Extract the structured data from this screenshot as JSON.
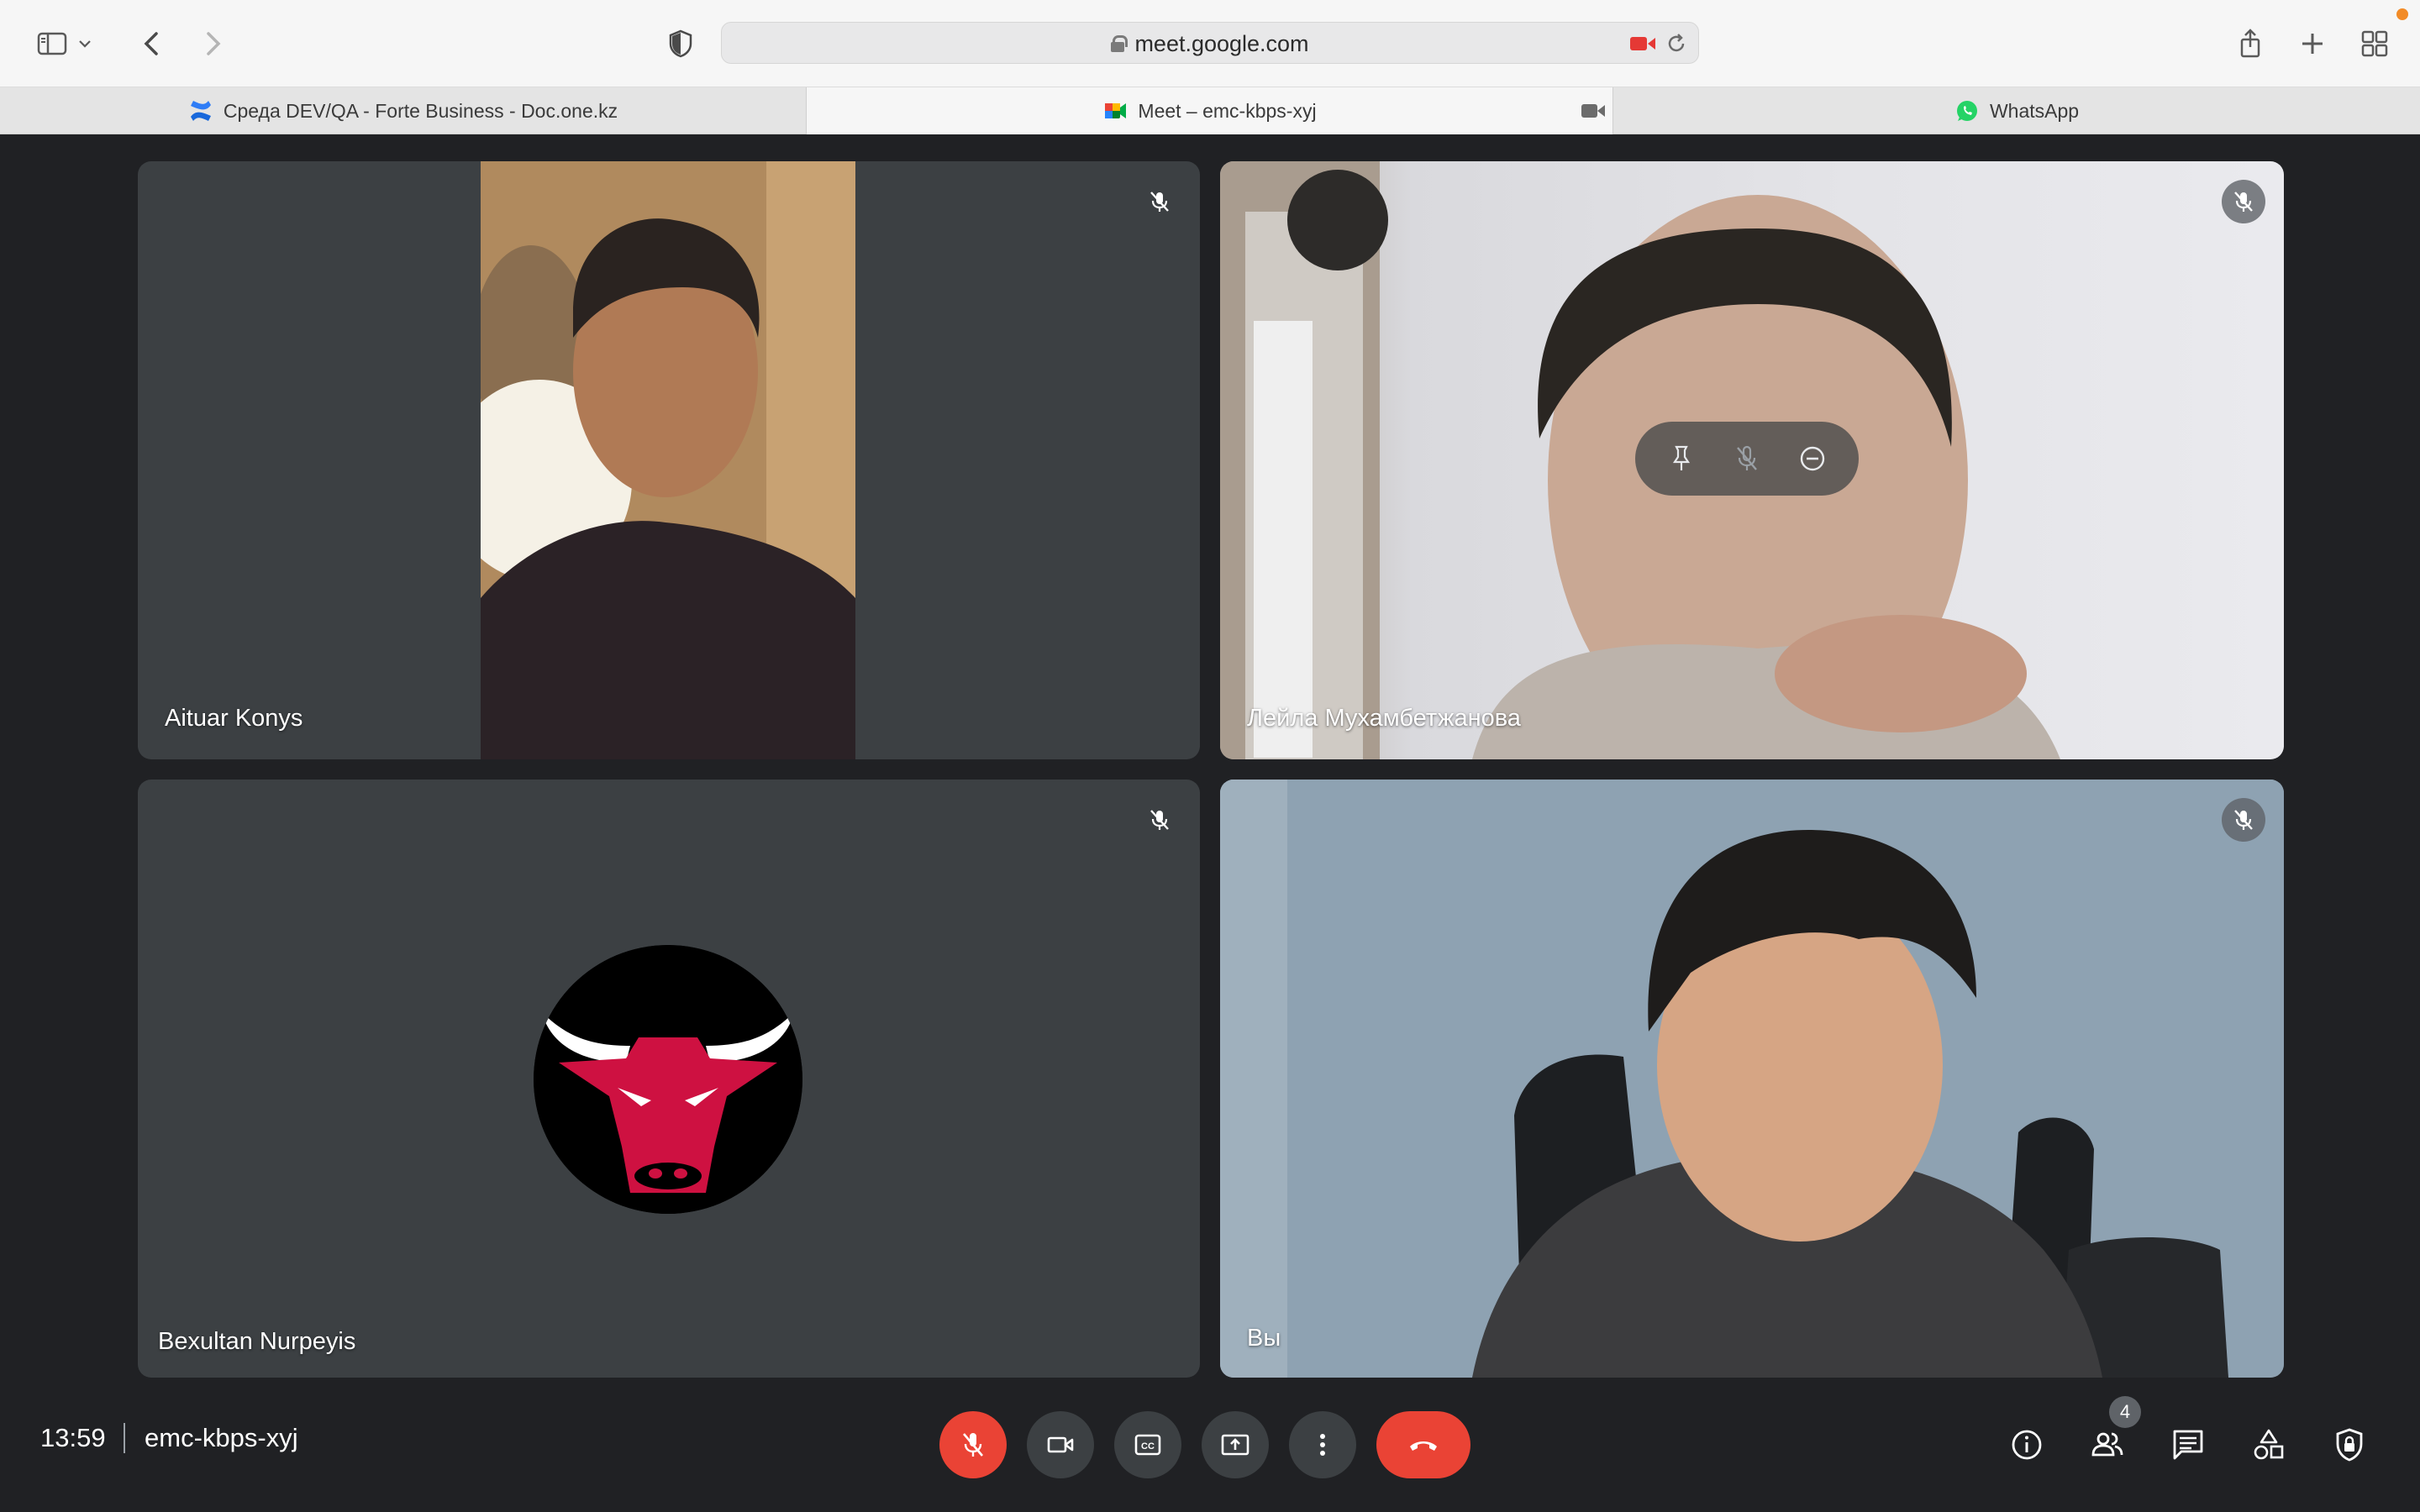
{
  "browser": {
    "url": "meet.google.com",
    "tabs": [
      {
        "label": "Среда DEV/QA - Forte Business - Doc.one.kz",
        "icon": "confluence-icon"
      },
      {
        "label": "Meet – emc-kbps-xyj",
        "icon": "google-meet-icon",
        "active": true
      },
      {
        "label": "WhatsApp",
        "icon": "whatsapp-icon"
      }
    ]
  },
  "participants": [
    {
      "name": "Aituar Konys",
      "muted": true
    },
    {
      "name": "Лейла Мухамбетжанова",
      "muted": true
    },
    {
      "name": "Bexultan Nurpeyis",
      "muted": true,
      "avatar": "chicago-bulls-logo"
    },
    {
      "name": "Вы",
      "muted": true
    }
  ],
  "bottom_bar": {
    "time": "13:59",
    "meeting_code": "emc-kbps-xyj",
    "people_count": "4"
  },
  "colors": {
    "background": "#202124",
    "tile": "#3c4043",
    "danger": "#ea4335"
  }
}
